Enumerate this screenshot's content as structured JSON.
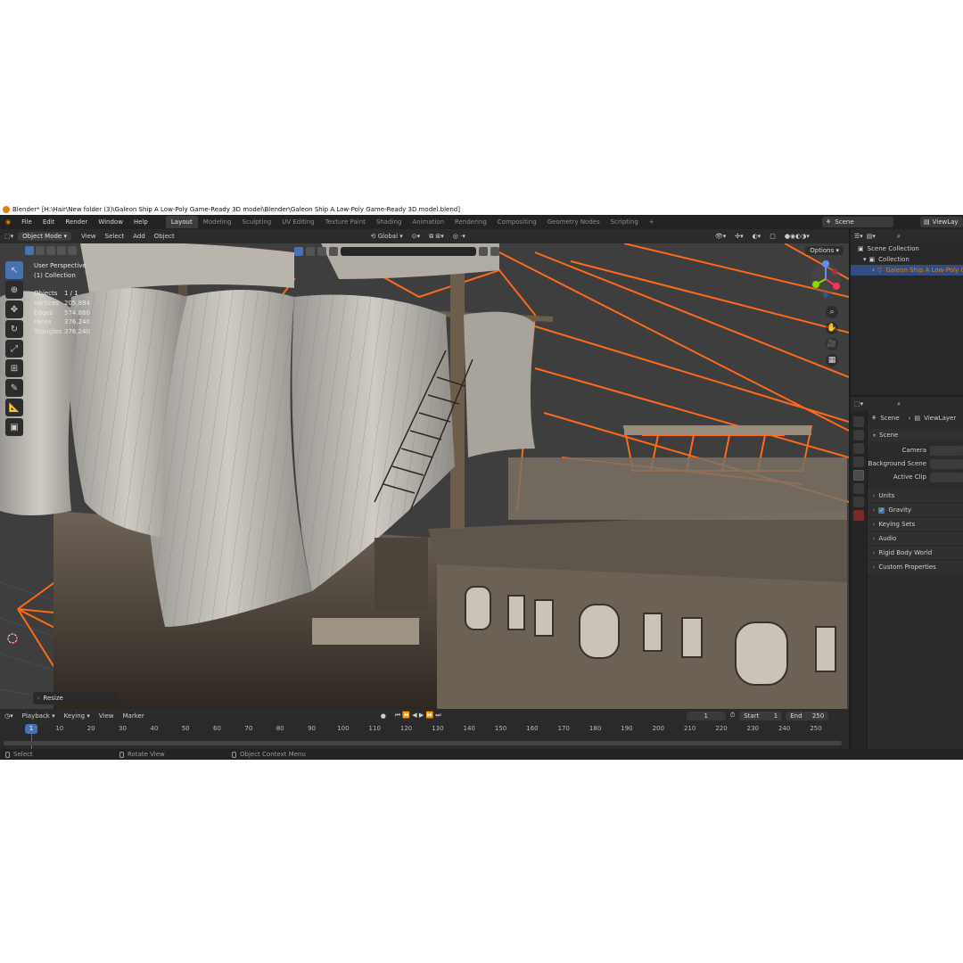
{
  "window": {
    "title": "Blender* [H:\\Hair\\New folder (3)\\Galeon Ship A Low-Poly Game-Ready 3D model\\Blender\\Galeon Ship A Low-Poly Game-Ready 3D model.blend]"
  },
  "menu": [
    "File",
    "Edit",
    "Render",
    "Window",
    "Help"
  ],
  "workspaces": [
    "Layout",
    "Modeling",
    "Sculpting",
    "UV Editing",
    "Texture Paint",
    "Shading",
    "Animation",
    "Rendering",
    "Compositing",
    "Geometry Nodes",
    "Scripting",
    "+"
  ],
  "active_workspace": "Layout",
  "scene_field": "Scene",
  "viewlayer_field": "ViewLay",
  "viewport_header": {
    "mode": "Object Mode",
    "menus": [
      "View",
      "Select",
      "Add",
      "Object"
    ],
    "transform": "Global",
    "options": "Options"
  },
  "overlay": {
    "perspective": "User Perspective",
    "collection": "(1) Collection",
    "stats": [
      {
        "k": "Objects",
        "v": "1 / 1"
      },
      {
        "k": "Vertices",
        "v": "205,894"
      },
      {
        "k": "Edges",
        "v": "574,880"
      },
      {
        "k": "Faces",
        "v": "376,240"
      },
      {
        "k": "Triangles",
        "v": "376,240"
      }
    ]
  },
  "resize_panel": "Resize",
  "timeline": {
    "menus": [
      "Playback",
      "Keying",
      "View",
      "Marker"
    ],
    "current_frame": "1",
    "start_label": "Start",
    "start": "1",
    "end_label": "End",
    "end": "250",
    "ticks": [
      "1",
      "10",
      "20",
      "30",
      "40",
      "50",
      "60",
      "70",
      "80",
      "90",
      "100",
      "110",
      "120",
      "130",
      "140",
      "150",
      "160",
      "170",
      "180",
      "190",
      "200",
      "210",
      "220",
      "230",
      "240",
      "250"
    ]
  },
  "statusbar": [
    "Select",
    "Rotate View",
    "Object Context Menu"
  ],
  "outliner": {
    "rows": [
      "Scene Collection",
      "Collection",
      "Galeon Ship A Low-Poly G"
    ]
  },
  "properties": {
    "breadcrumb_scene": "Scene",
    "breadcrumb_viewlayer": "ViewLayer",
    "section": "Scene",
    "fields": [
      "Camera",
      "Background Scene",
      "Active Clip"
    ],
    "subsections": [
      "Units",
      "Gravity",
      "Keying Sets",
      "Audio",
      "Rigid Body World",
      "Custom Properties"
    ]
  },
  "colors": {
    "selection_orange": "#e87d0d",
    "accent_blue": "#4772b3",
    "viewport_bg": "#3d3d3d"
  }
}
